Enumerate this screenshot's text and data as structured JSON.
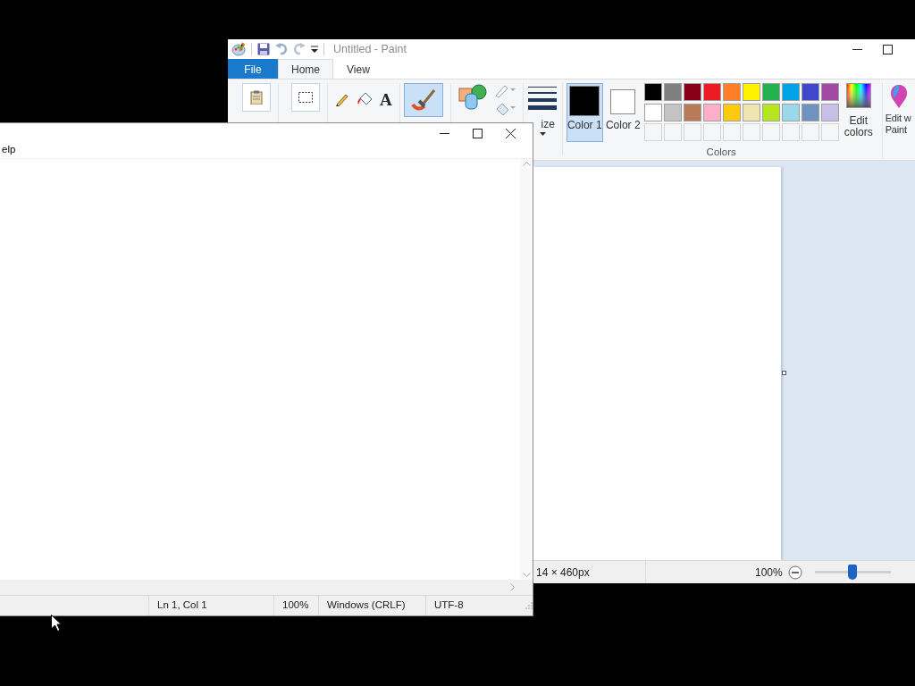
{
  "paint": {
    "title": "Untitled - Paint",
    "tabs": [
      {
        "label": "File",
        "kind": "file",
        "selected": false
      },
      {
        "label": "Home",
        "kind": "tab",
        "selected": true
      },
      {
        "label": "View",
        "kind": "tab",
        "selected": false
      }
    ],
    "text_tool": "A",
    "size_label": "ize",
    "color_slots": [
      {
        "label": "Color 1",
        "selected": true,
        "color": "#000000"
      },
      {
        "label": "Color 2",
        "selected": false,
        "color": "#ffffff"
      }
    ],
    "palette": [
      {
        "color": "#000000"
      },
      {
        "color": "#7f7f7f"
      },
      {
        "color": "#880015"
      },
      {
        "color": "#ed1c24"
      },
      {
        "color": "#ff7f27"
      },
      {
        "color": "#fff200"
      },
      {
        "color": "#22b14c"
      },
      {
        "color": "#00a2e8"
      },
      {
        "color": "#3f48cc"
      },
      {
        "color": "#a349a4"
      },
      {
        "color": "#ffffff"
      },
      {
        "color": "#c3c3c3"
      },
      {
        "color": "#b97a57"
      },
      {
        "color": "#ffaec9"
      },
      {
        "color": "#ffc90e"
      },
      {
        "color": "#efe4b0"
      },
      {
        "color": "#b5e61d"
      },
      {
        "color": "#99d9ea"
      },
      {
        "color": "#7092be"
      },
      {
        "color": "#c8bfe7"
      }
    ],
    "edit_colors": "Edit colors",
    "paint3d_lines": [
      "Edit w",
      "Paint"
    ],
    "group_label": "Colors",
    "status": {
      "dimensions": "14 × 460px",
      "zoom": "100%",
      "level": 0.5
    }
  },
  "notepad": {
    "menu_item": "elp",
    "status": {
      "position": "Ln 1, Col 1",
      "zoom": "100%",
      "line_ending": "Windows (CRLF)",
      "encoding": "UTF-8"
    }
  }
}
